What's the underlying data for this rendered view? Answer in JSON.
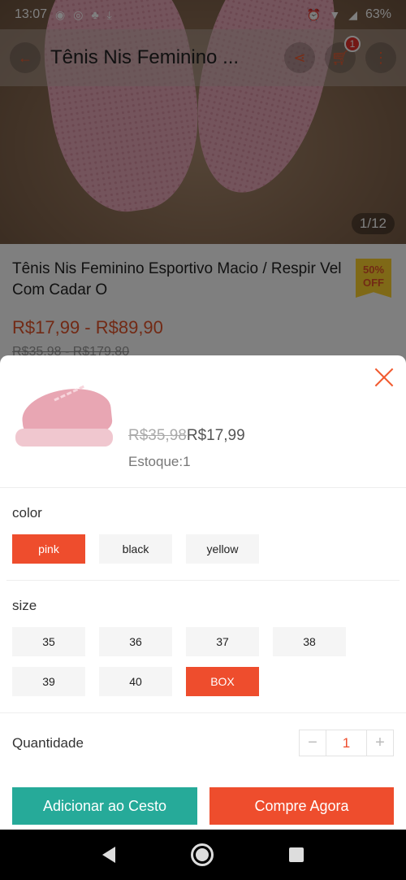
{
  "status_bar": {
    "time": "13:07",
    "battery": "63%"
  },
  "topbar": {
    "title": "Tênis Nis Feminino ...",
    "cart_count": "1"
  },
  "hero": {
    "image_counter": "1/12"
  },
  "product": {
    "title": "Tênis Nis Feminino Esportivo Macio / Respir Vel Com Cadar O",
    "badge_line1": "50%",
    "badge_line2": "OFF",
    "price_range": "R$17,99 - R$89,90",
    "original_range": "R$35,98 - R$179,80"
  },
  "sheet": {
    "original_price": "R$35,98",
    "price": "R$17,99",
    "stock_label": "Estoque:",
    "stock_value": "1",
    "color_label": "color",
    "colors": [
      "pink",
      "black",
      "yellow"
    ],
    "selected_color": "pink",
    "size_label": "size",
    "sizes": [
      "35",
      "36",
      "37",
      "38",
      "39",
      "40",
      "BOX"
    ],
    "selected_size": "BOX",
    "quantity_label": "Quantidade",
    "quantity": "1",
    "add_to_cart": "Adicionar ao Cesto",
    "buy_now": "Compre Agora"
  },
  "colors": {
    "accent": "#ee4d2d",
    "cart_button": "#26aa99",
    "badge": "#ffd22e"
  }
}
